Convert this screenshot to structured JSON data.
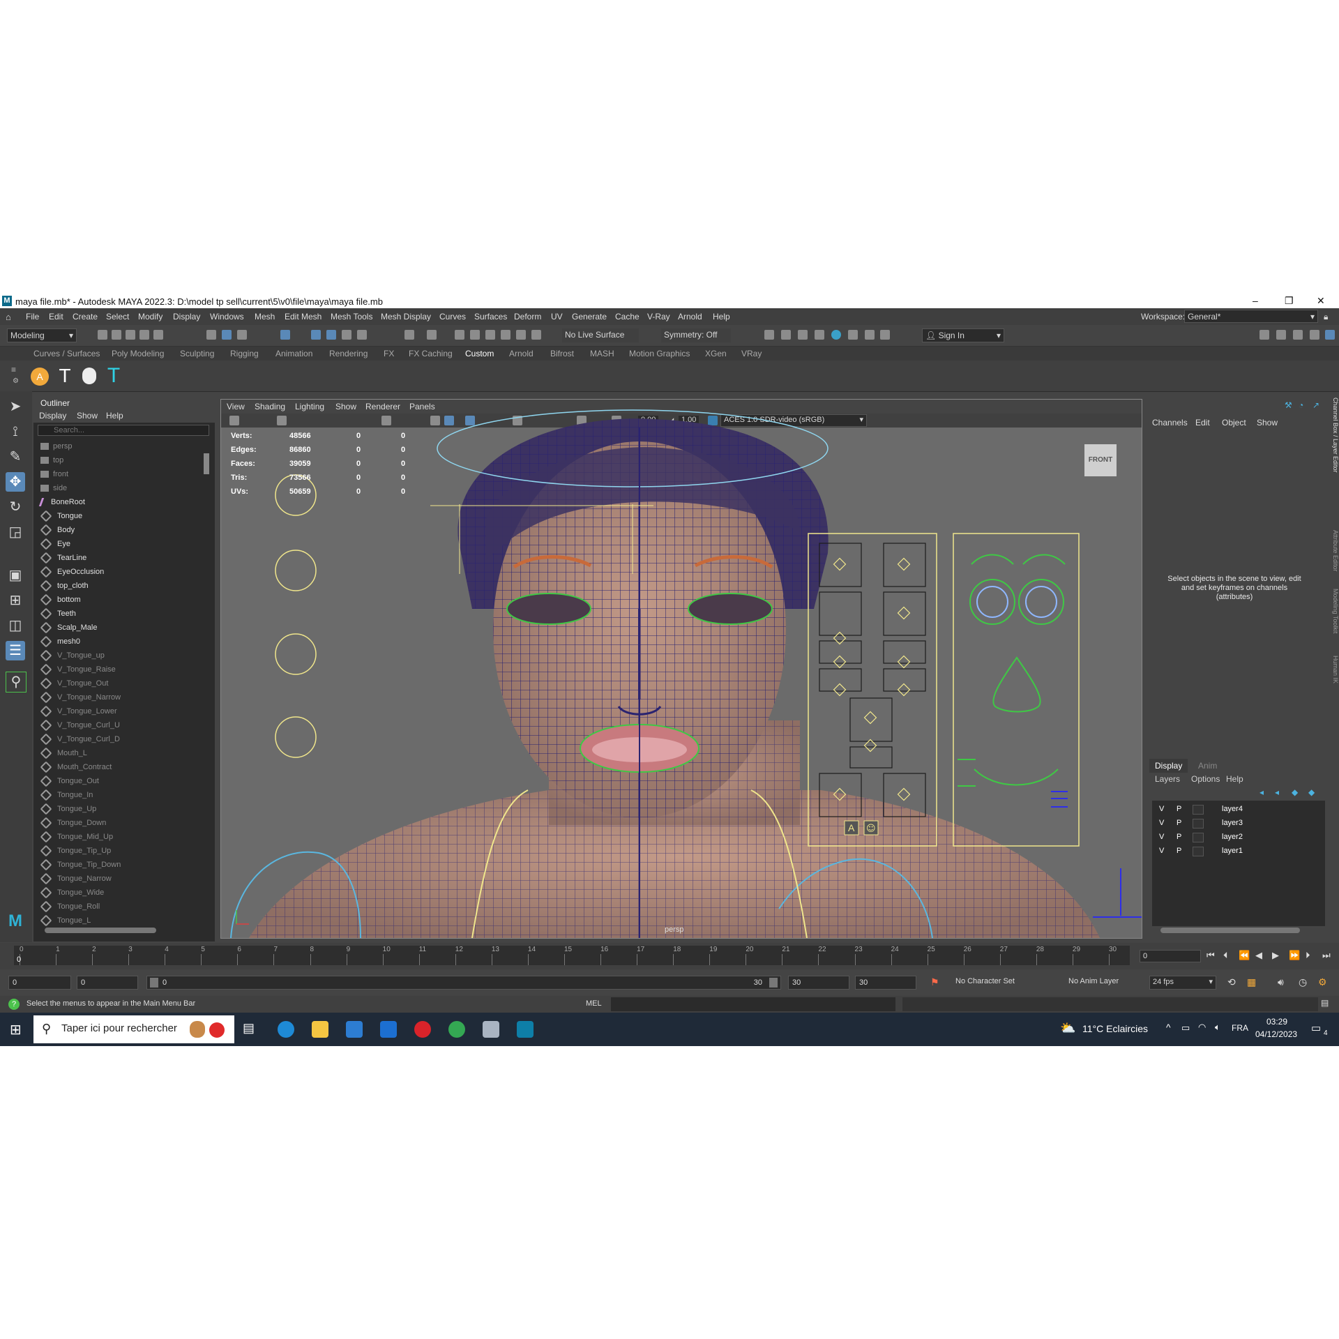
{
  "window": {
    "title": "maya file.mb* - Autodesk MAYA 2022.3: D:\\model tp sell\\current\\5\\v0\\file\\maya\\maya file.mb",
    "logo": "M"
  },
  "menubar": {
    "items": [
      "File",
      "Edit",
      "Create",
      "Select",
      "Modify",
      "Display",
      "Windows",
      "Mesh",
      "Edit Mesh",
      "Mesh Tools",
      "Mesh Display",
      "Curves",
      "Surfaces",
      "Deform",
      "UV",
      "Generate",
      "Cache",
      "V-Ray",
      "Arnold",
      "Help"
    ],
    "workspace_label": "Workspace:",
    "workspace_value": "General*"
  },
  "toolbar": {
    "mode": "Modeling",
    "live_surface": "No Live Surface",
    "symmetry": "Symmetry: Off",
    "sign_in": "Sign In"
  },
  "shelf_tabs": [
    "Curves / Surfaces",
    "Poly Modeling",
    "Sculpting",
    "Rigging",
    "Animation",
    "Rendering",
    "FX",
    "FX Caching",
    "Custom",
    "Arnold",
    "Bifrost",
    "MASH",
    "Motion Graphics",
    "XGen",
    "VRay"
  ],
  "shelf_active": "Custom",
  "outliner": {
    "title": "Outliner",
    "menu": [
      "Display",
      "Show",
      "Help"
    ],
    "search_placeholder": "Search...",
    "items": [
      {
        "name": "persp",
        "kind": "cam"
      },
      {
        "name": "top",
        "kind": "cam"
      },
      {
        "name": "front",
        "kind": "cam"
      },
      {
        "name": "side",
        "kind": "cam"
      },
      {
        "name": "BoneRoot",
        "kind": "bone"
      },
      {
        "name": "Tongue",
        "kind": "mesh"
      },
      {
        "name": "Body",
        "kind": "mesh"
      },
      {
        "name": "Eye",
        "kind": "mesh"
      },
      {
        "name": "TearLine",
        "kind": "mesh"
      },
      {
        "name": "EyeOcclusion",
        "kind": "mesh"
      },
      {
        "name": "top_cloth",
        "kind": "mesh"
      },
      {
        "name": "bottom",
        "kind": "mesh"
      },
      {
        "name": "Teeth",
        "kind": "mesh"
      },
      {
        "name": "Scalp_Male",
        "kind": "mesh"
      },
      {
        "name": "mesh0",
        "kind": "mesh"
      },
      {
        "name": "V_Tongue_up",
        "kind": "mesh"
      },
      {
        "name": "V_Tongue_Raise",
        "kind": "mesh"
      },
      {
        "name": "V_Tongue_Out",
        "kind": "mesh"
      },
      {
        "name": "V_Tongue_Narrow",
        "kind": "mesh"
      },
      {
        "name": "V_Tongue_Lower",
        "kind": "mesh"
      },
      {
        "name": "V_Tongue_Curl_U",
        "kind": "mesh"
      },
      {
        "name": "V_Tongue_Curl_D",
        "kind": "mesh"
      },
      {
        "name": "Mouth_L",
        "kind": "mesh"
      },
      {
        "name": "Mouth_Contract",
        "kind": "mesh"
      },
      {
        "name": "Tongue_Out",
        "kind": "mesh"
      },
      {
        "name": "Tongue_In",
        "kind": "mesh"
      },
      {
        "name": "Tongue_Up",
        "kind": "mesh"
      },
      {
        "name": "Tongue_Down",
        "kind": "mesh"
      },
      {
        "name": "Tongue_Mid_Up",
        "kind": "mesh"
      },
      {
        "name": "Tongue_Tip_Up",
        "kind": "mesh"
      },
      {
        "name": "Tongue_Tip_Down",
        "kind": "mesh"
      },
      {
        "name": "Tongue_Narrow",
        "kind": "mesh"
      },
      {
        "name": "Tongue_Wide",
        "kind": "mesh"
      },
      {
        "name": "Tongue_Roll",
        "kind": "mesh"
      },
      {
        "name": "Tongue_L",
        "kind": "mesh"
      }
    ]
  },
  "viewport": {
    "menu": [
      "View",
      "Shading",
      "Lighting",
      "Show",
      "Renderer",
      "Panels"
    ],
    "exposure": "0.00",
    "gamma": "1.00",
    "color_space": "ACES 1.0 SDR-video (sRGB)",
    "view_cube": "FRONT",
    "camera_label": "persp",
    "hud": [
      {
        "label": "Verts:",
        "v1": "48566",
        "v2": "0",
        "v3": "0"
      },
      {
        "label": "Edges:",
        "v1": "86860",
        "v2": "0",
        "v3": "0"
      },
      {
        "label": "Faces:",
        "v1": "39059",
        "v2": "0",
        "v3": "0"
      },
      {
        "label": "Tris:",
        "v1": "73566",
        "v2": "0",
        "v3": "0"
      },
      {
        "label": "UVs:",
        "v1": "50659",
        "v2": "0",
        "v3": "0"
      }
    ],
    "control_labels": [
      "A",
      "☺"
    ]
  },
  "channel_box": {
    "menu": [
      "Channels",
      "Edit",
      "Object",
      "Show"
    ],
    "hint": "Select objects in the scene to view, edit and set keyframes on channels (attributes)",
    "side_tabs": [
      "Channel Box / Layer Editor",
      "Attribute Editor",
      "Modeling Toolkit",
      "Human IK"
    ]
  },
  "layer_editor": {
    "tabs": [
      "Display",
      "Anim"
    ],
    "menu": [
      "Layers",
      "Options",
      "Help"
    ],
    "layers": [
      {
        "v": "V",
        "p": "P",
        "name": "layer4"
      },
      {
        "v": "V",
        "p": "P",
        "name": "layer3"
      },
      {
        "v": "V",
        "p": "P",
        "name": "layer2"
      },
      {
        "v": "V",
        "p": "P",
        "name": "layer1"
      }
    ]
  },
  "timeline": {
    "ticks": [
      "0",
      "1",
      "2",
      "3",
      "4",
      "5",
      "6",
      "7",
      "8",
      "9",
      "10",
      "11",
      "12",
      "13",
      "14",
      "15",
      "16",
      "17",
      "18",
      "19",
      "20",
      "21",
      "22",
      "23",
      "24",
      "25",
      "26",
      "27",
      "28",
      "29",
      "30"
    ],
    "current_frame_marker": "0",
    "current_frame": "0"
  },
  "range": {
    "start": "0",
    "anim_start": "0",
    "slider_left": "0",
    "slider_right": "30",
    "end": "30",
    "anim_end": "30",
    "character_set": "No Character Set",
    "anim_layer": "No Anim Layer",
    "fps": "24 fps"
  },
  "command_line": {
    "help": "Select the menus to appear in the Main Menu Bar",
    "lang": "MEL"
  },
  "taskbar": {
    "search": "Taper ici pour rechercher",
    "weather": "11°C  Eclaircies",
    "lang": "FRA",
    "time": "03:29",
    "date": "04/12/2023",
    "notif": "4"
  },
  "colors": {
    "panel": "#444444",
    "dark": "#2b2b2b",
    "viewport": "#6b6b6b",
    "accent": "#5a89b8",
    "control_yellow": "#f0e68c",
    "control_green": "#3fc845",
    "wire": "#2a2370"
  }
}
